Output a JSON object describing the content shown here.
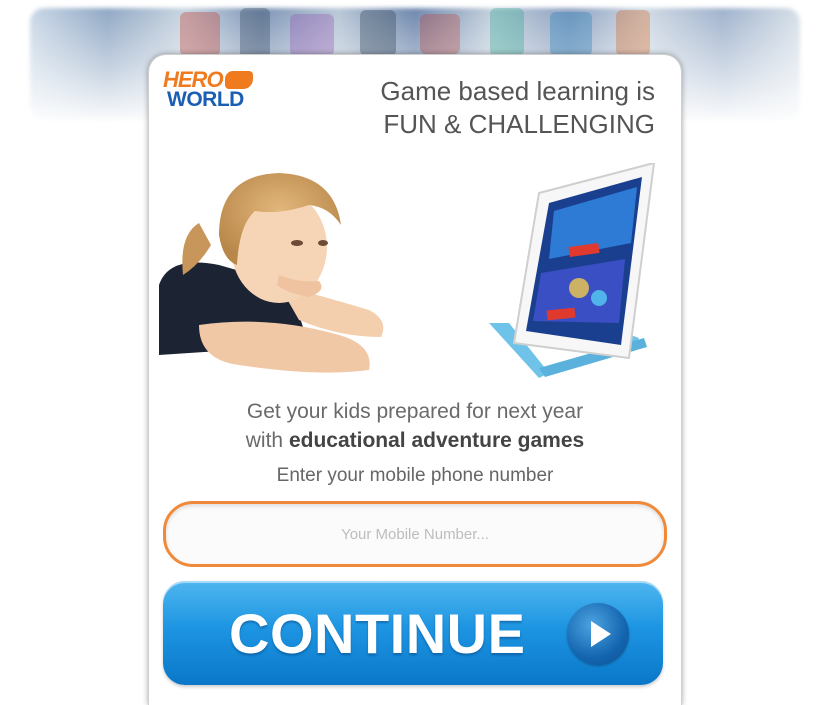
{
  "logo": {
    "line1": "HERO",
    "line2": "WORLD"
  },
  "headline": {
    "line1": "Game based learning is",
    "line2": "FUN & CHALLENGING"
  },
  "subcopy": {
    "line1": "Get your kids prepared for next year",
    "line2_prefix": "with ",
    "line2_bold": "educational adventure games"
  },
  "form": {
    "prompt": "Enter your mobile phone number",
    "phone_placeholder": "Your Mobile Number...",
    "phone_value": ""
  },
  "cta": {
    "label": "CONTINUE",
    "icon": "play-icon"
  },
  "colors": {
    "accent_orange": "#f08a3a",
    "button_blue": "#1d95e2",
    "logo_blue": "#1a5fb4"
  }
}
